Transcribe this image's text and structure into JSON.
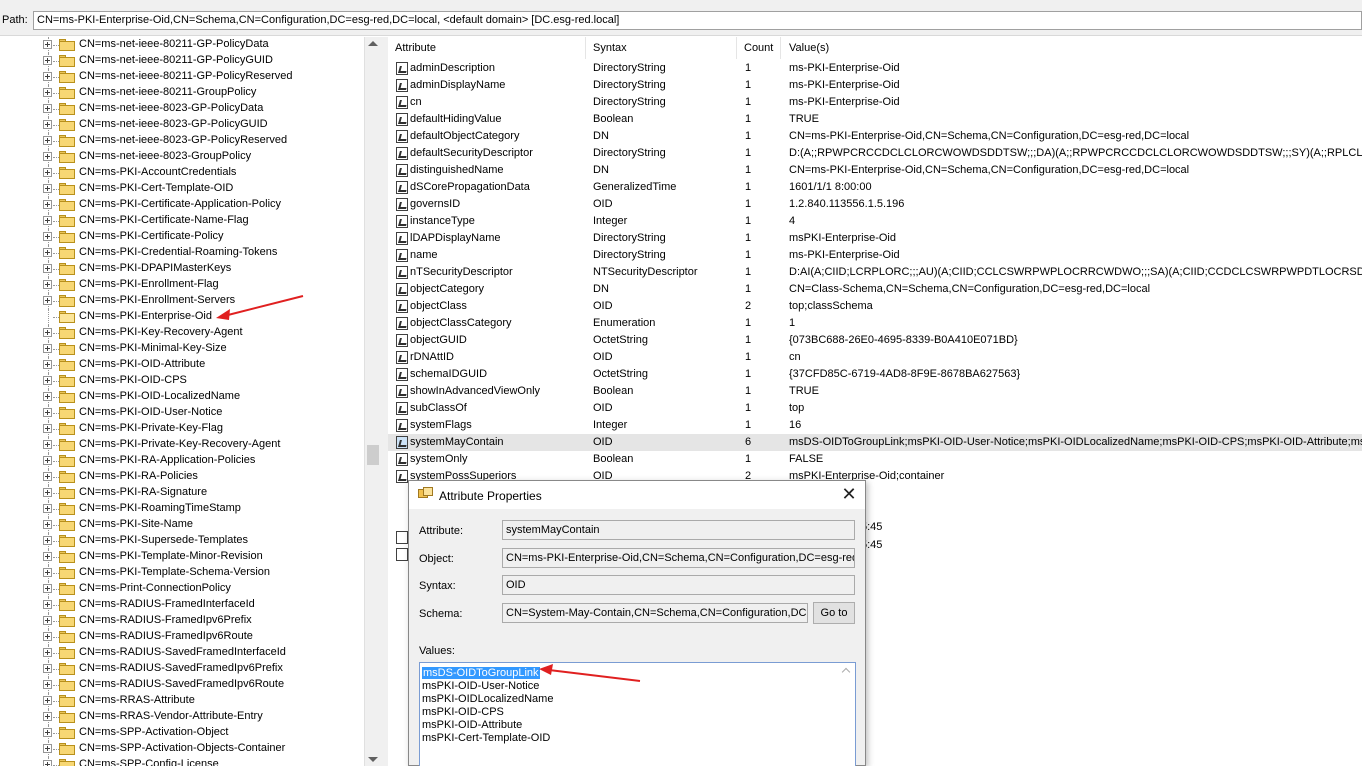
{
  "path": {
    "label": "Path:",
    "value": "CN=ms-PKI-Enterprise-Oid,CN=Schema,CN=Configuration,DC=esg-red,DC=local, <default domain> [DC.esg-red.local]"
  },
  "tree": {
    "items": [
      "CN=ms-net-ieee-80211-GP-PolicyData",
      "CN=ms-net-ieee-80211-GP-PolicyGUID",
      "CN=ms-net-ieee-80211-GP-PolicyReserved",
      "CN=ms-net-ieee-80211-GroupPolicy",
      "CN=ms-net-ieee-8023-GP-PolicyData",
      "CN=ms-net-ieee-8023-GP-PolicyGUID",
      "CN=ms-net-ieee-8023-GP-PolicyReserved",
      "CN=ms-net-ieee-8023-GroupPolicy",
      "CN=ms-PKI-AccountCredentials",
      "CN=ms-PKI-Cert-Template-OID",
      "CN=ms-PKI-Certificate-Application-Policy",
      "CN=ms-PKI-Certificate-Name-Flag",
      "CN=ms-PKI-Certificate-Policy",
      "CN=ms-PKI-Credential-Roaming-Tokens",
      "CN=ms-PKI-DPAPIMasterKeys",
      "CN=ms-PKI-Enrollment-Flag",
      "CN=ms-PKI-Enrollment-Servers",
      "CN=ms-PKI-Enterprise-Oid",
      "CN=ms-PKI-Key-Recovery-Agent",
      "CN=ms-PKI-Minimal-Key-Size",
      "CN=ms-PKI-OID-Attribute",
      "CN=ms-PKI-OID-CPS",
      "CN=ms-PKI-OID-LocalizedName",
      "CN=ms-PKI-OID-User-Notice",
      "CN=ms-PKI-Private-Key-Flag",
      "CN=ms-PKI-Private-Key-Recovery-Agent",
      "CN=ms-PKI-RA-Application-Policies",
      "CN=ms-PKI-RA-Policies",
      "CN=ms-PKI-RA-Signature",
      "CN=ms-PKI-RoamingTimeStamp",
      "CN=ms-PKI-Site-Name",
      "CN=ms-PKI-Supersede-Templates",
      "CN=ms-PKI-Template-Minor-Revision",
      "CN=ms-PKI-Template-Schema-Version",
      "CN=ms-Print-ConnectionPolicy",
      "CN=ms-RADIUS-FramedInterfaceId",
      "CN=ms-RADIUS-FramedIpv6Prefix",
      "CN=ms-RADIUS-FramedIpv6Route",
      "CN=ms-RADIUS-SavedFramedInterfaceId",
      "CN=ms-RADIUS-SavedFramedIpv6Prefix",
      "CN=ms-RADIUS-SavedFramedIpv6Route",
      "CN=ms-RRAS-Attribute",
      "CN=ms-RRAS-Vendor-Attribute-Entry",
      "CN=ms-SPP-Activation-Object",
      "CN=ms-SPP-Activation-Objects-Container",
      "CN=ms-SPP-Config-License"
    ]
  },
  "columns": {
    "attribute": "Attribute",
    "syntax": "Syntax",
    "count": "Count",
    "values": "Value(s)"
  },
  "attributes": [
    {
      "name": "adminDescription",
      "syntax": "DirectoryString",
      "count": "1",
      "value": "ms-PKI-Enterprise-Oid"
    },
    {
      "name": "adminDisplayName",
      "syntax": "DirectoryString",
      "count": "1",
      "value": "ms-PKI-Enterprise-Oid"
    },
    {
      "name": "cn",
      "syntax": "DirectoryString",
      "count": "1",
      "value": "ms-PKI-Enterprise-Oid"
    },
    {
      "name": "defaultHidingValue",
      "syntax": "Boolean",
      "count": "1",
      "value": "TRUE"
    },
    {
      "name": "defaultObjectCategory",
      "syntax": "DN",
      "count": "1",
      "value": "CN=ms-PKI-Enterprise-Oid,CN=Schema,CN=Configuration,DC=esg-red,DC=local"
    },
    {
      "name": "defaultSecurityDescriptor",
      "syntax": "DirectoryString",
      "count": "1",
      "value": "D:(A;;RPWPCRCCDCLCLORCWOWDSDDTSW;;;DA)(A;;RPWPCRCCDCLCLORCWOWDSDDTSW;;;SY)(A;;RPLCLORC;;;AU)"
    },
    {
      "name": "distinguishedName",
      "syntax": "DN",
      "count": "1",
      "value": "CN=ms-PKI-Enterprise-Oid,CN=Schema,CN=Configuration,DC=esg-red,DC=local"
    },
    {
      "name": "dSCorePropagationData",
      "syntax": "GeneralizedTime",
      "count": "1",
      "value": "1601/1/1 8:00:00"
    },
    {
      "name": "governsID",
      "syntax": "OID",
      "count": "1",
      "value": "1.2.840.113556.1.5.196"
    },
    {
      "name": "instanceType",
      "syntax": "Integer",
      "count": "1",
      "value": "4"
    },
    {
      "name": "lDAPDisplayName",
      "syntax": "DirectoryString",
      "count": "1",
      "value": "msPKI-Enterprise-Oid"
    },
    {
      "name": "name",
      "syntax": "DirectoryString",
      "count": "1",
      "value": "ms-PKI-Enterprise-Oid"
    },
    {
      "name": "nTSecurityDescriptor",
      "syntax": "NTSecurityDescriptor",
      "count": "1",
      "value": "D:AI(A;CIID;LCRPLORC;;;AU)(A;CIID;CCLCSWRPWPLOCRRCWDWO;;;SA)(A;CIID;CCDCLCSWRPWPDTLOCRSDRCWDWO"
    },
    {
      "name": "objectCategory",
      "syntax": "DN",
      "count": "1",
      "value": "CN=Class-Schema,CN=Schema,CN=Configuration,DC=esg-red,DC=local"
    },
    {
      "name": "objectClass",
      "syntax": "OID",
      "count": "2",
      "value": "top;classSchema"
    },
    {
      "name": "objectClassCategory",
      "syntax": "Enumeration",
      "count": "1",
      "value": "1"
    },
    {
      "name": "objectGUID",
      "syntax": "OctetString",
      "count": "1",
      "value": "{073BC688-26E0-4695-8339-B0A410E071BD}"
    },
    {
      "name": "rDNAttID",
      "syntax": "OID",
      "count": "1",
      "value": "cn"
    },
    {
      "name": "schemaIDGUID",
      "syntax": "OctetString",
      "count": "1",
      "value": "{37CFD85C-6719-4AD8-8F9E-8678BA627563}"
    },
    {
      "name": "showInAdvancedViewOnly",
      "syntax": "Boolean",
      "count": "1",
      "value": "TRUE"
    },
    {
      "name": "subClassOf",
      "syntax": "OID",
      "count": "1",
      "value": "top"
    },
    {
      "name": "systemFlags",
      "syntax": "Integer",
      "count": "1",
      "value": "16"
    },
    {
      "name": "systemMayContain",
      "syntax": "OID",
      "count": "6",
      "value": "msDS-OIDToGroupLink;msPKI-OID-User-Notice;msPKI-OIDLocalizedName;msPKI-OID-CPS;msPKI-OID-Attribute;msPKI-C"
    },
    {
      "name": "systemOnly",
      "syntax": "Boolean",
      "count": "1",
      "value": "FALSE"
    },
    {
      "name": "systemPossSuperiors",
      "syntax": "OID",
      "count": "2",
      "value": "msPKI-Enterprise-Oid;container"
    }
  ],
  "obscured_fragments": [
    "5:45",
    "5:45"
  ],
  "dialog": {
    "title": "Attribute Properties",
    "close": "✕",
    "attribute_label": "Attribute:",
    "attribute_value": "systemMayContain",
    "object_label": "Object:",
    "object_value": "CN=ms-PKI-Enterprise-Oid,CN=Schema,CN=Configuration,DC=esg-red,DC",
    "syntax_label": "Syntax:",
    "syntax_value": "OID",
    "schema_label": "Schema:",
    "schema_value": "CN=System-May-Contain,CN=Schema,CN=Configuration,DC=es",
    "goto_label": "Go to",
    "values_label": "Values:",
    "values": [
      "msDS-OIDToGroupLink",
      "msPKI-OID-User-Notice",
      "msPKI-OIDLocalizedName",
      "msPKI-OID-CPS",
      "msPKI-OID-Attribute",
      "msPKI-Cert-Template-OID"
    ]
  },
  "colors": {
    "selection": "#3399ff",
    "annotation_arrow": "#e02020",
    "row_highlight": "#e5e5e5"
  }
}
